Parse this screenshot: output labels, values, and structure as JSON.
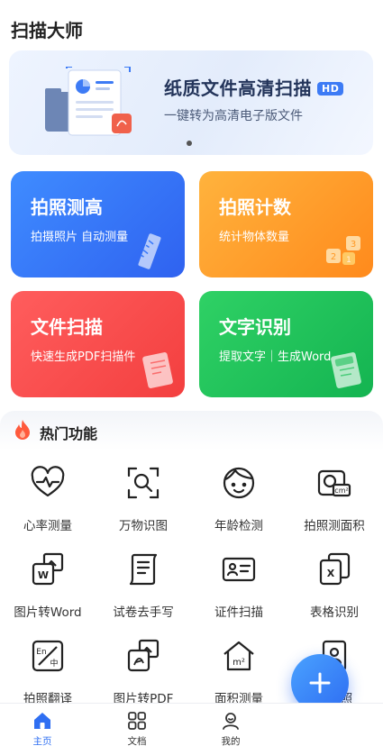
{
  "app": {
    "title": "扫描大师"
  },
  "banner": {
    "title": "纸质文件高清扫描",
    "badge": "HD",
    "subtitle": "一键转为高清电子版文件",
    "page_count": 1,
    "active_page": 1
  },
  "cards": [
    {
      "title": "拍照测高",
      "subtitle": "拍摄照片 自动测量",
      "icon": "ruler-icon",
      "color": "#3a7bfb"
    },
    {
      "title": "拍照计数",
      "subtitle": "统计物体数量",
      "icon": "number-blocks-icon",
      "color": "#ff9a26"
    },
    {
      "title": "文件扫描",
      "subtitle": "快速生成PDF扫描件",
      "icon": "pdf-document-icon",
      "color": "#f94a4a"
    },
    {
      "title": "文字识别",
      "subtitle": "提取文字｜生成Word",
      "icon": "ocr-document-icon",
      "color": "#1fc25b"
    }
  ],
  "hot": {
    "title": "热门功能",
    "icon": "flame-icon",
    "tools": [
      {
        "label": "心率测量",
        "icon": "heart-rate-icon"
      },
      {
        "label": "万物识图",
        "icon": "scan-search-icon"
      },
      {
        "label": "年龄检测",
        "icon": "face-icon"
      },
      {
        "label": "拍照测面积",
        "icon": "camera-area-icon"
      },
      {
        "label": "图片转Word",
        "icon": "image-to-word-icon"
      },
      {
        "label": "试卷去手写",
        "icon": "paper-scroll-icon"
      },
      {
        "label": "证件扫描",
        "icon": "id-card-icon"
      },
      {
        "label": "表格识别",
        "icon": "table-excel-icon"
      },
      {
        "label": "拍照翻译",
        "icon": "translate-icon"
      },
      {
        "label": "图片转PDF",
        "icon": "image-to-pdf-icon"
      },
      {
        "label": "面积测量",
        "icon": "house-area-icon"
      },
      {
        "label": "证件照",
        "icon": "id-photo-icon"
      }
    ]
  },
  "fab": {
    "icon": "plus-icon"
  },
  "nav": {
    "items": [
      {
        "label": "主页",
        "icon": "home-icon",
        "active": true
      },
      {
        "label": "文档",
        "icon": "grid-icon",
        "active": false
      },
      {
        "label": "我的",
        "icon": "user-icon",
        "active": false
      }
    ]
  },
  "colors": {
    "accent": "#2f6ff2",
    "text": "#222222"
  }
}
